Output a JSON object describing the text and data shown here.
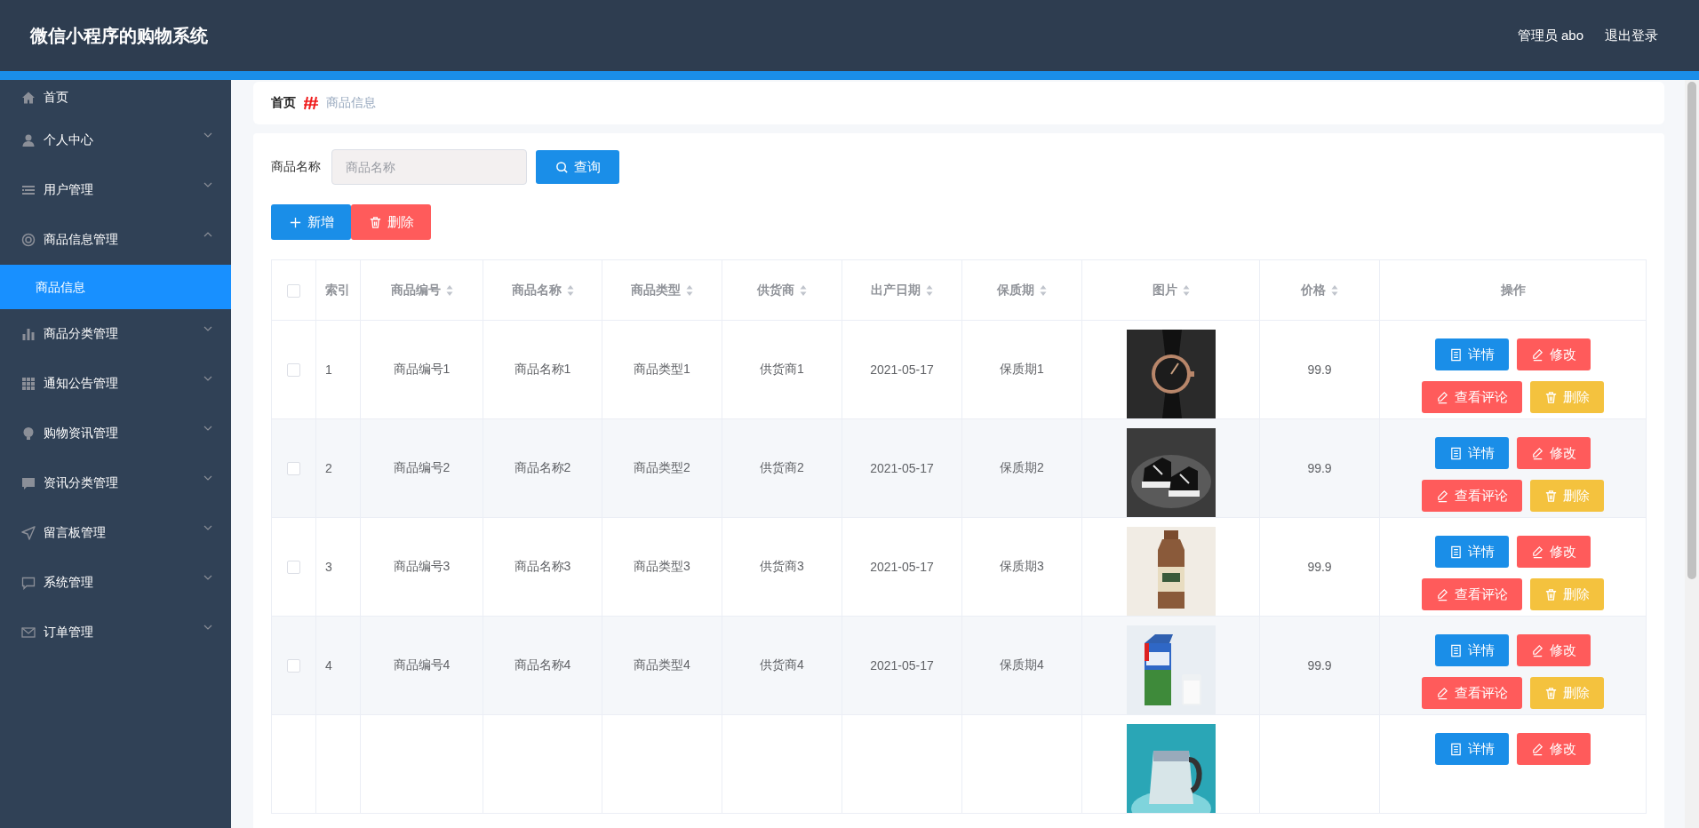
{
  "header": {
    "title": "微信小程序的购物系统",
    "user": "管理员 abo",
    "logout": "退出登录"
  },
  "sidebar": {
    "items": [
      {
        "label": "首页",
        "selected": false
      },
      {
        "label": "个人中心",
        "selected": false,
        "expanded": false
      },
      {
        "label": "用户管理",
        "selected": false,
        "expanded": false
      },
      {
        "label": "商品信息管理",
        "selected": false,
        "expanded": true,
        "children": [
          {
            "label": "商品信息",
            "selected": true
          }
        ]
      },
      {
        "label": "商品分类管理",
        "selected": false,
        "expanded": false
      },
      {
        "label": "通知公告管理",
        "selected": false,
        "expanded": false
      },
      {
        "label": "购物资讯管理",
        "selected": false,
        "expanded": false
      },
      {
        "label": "资讯分类管理",
        "selected": false,
        "expanded": false
      },
      {
        "label": "留言板管理",
        "selected": false,
        "expanded": false
      },
      {
        "label": "系统管理",
        "selected": false,
        "expanded": false
      },
      {
        "label": "订单管理",
        "selected": false,
        "expanded": false
      }
    ]
  },
  "breadcrumb": {
    "home": "首页",
    "current": "商品信息"
  },
  "search": {
    "label": "商品名称",
    "placeholder": "商品名称",
    "button": "查询"
  },
  "toolbar": [
    {
      "label": "新增",
      "kind": "add"
    },
    {
      "label": "删除",
      "kind": "delete"
    }
  ],
  "table": {
    "header_checked": false,
    "columns": [
      {
        "label": "索引",
        "sortable": false
      },
      {
        "label": "商品编号",
        "sortable": true
      },
      {
        "label": "商品名称",
        "sortable": true
      },
      {
        "label": "商品类型",
        "sortable": true
      },
      {
        "label": "供货商",
        "sortable": true
      },
      {
        "label": "出产日期",
        "sortable": true
      },
      {
        "label": "保质期",
        "sortable": true
      },
      {
        "label": "图片",
        "sortable": true
      },
      {
        "label": "价格",
        "sortable": true
      },
      {
        "label": "操作",
        "sortable": false
      }
    ],
    "rows": [
      {
        "checked": false,
        "cells": [
          "1",
          "商品编号1",
          "商品名称1",
          "商品类型1",
          "供货商1",
          "2021-05-17",
          "保质期1"
        ],
        "picture": {
          "kind": "picture"
        },
        "price": "99.9",
        "actions": [
          {
            "label": "详情",
            "kind": "detail"
          },
          {
            "label": "修改",
            "kind": "edit"
          },
          {
            "label": "查看评论",
            "kind": "comments"
          },
          {
            "label": "删除",
            "kind": "delete"
          }
        ]
      },
      {
        "checked": false,
        "cells": [
          "2",
          "商品编号2",
          "商品名称2",
          "商品类型2",
          "供货商2",
          "2021-05-17",
          "保质期2"
        ],
        "picture": {
          "kind": "picture"
        },
        "price": "99.9",
        "actions": [
          {
            "label": "详情",
            "kind": "detail"
          },
          {
            "label": "修改",
            "kind": "edit"
          },
          {
            "label": "查看评论",
            "kind": "comments"
          },
          {
            "label": "删除",
            "kind": "delete"
          }
        ]
      },
      {
        "checked": false,
        "cells": [
          "3",
          "商品编号3",
          "商品名称3",
          "商品类型3",
          "供货商3",
          "2021-05-17",
          "保质期3"
        ],
        "picture": {
          "kind": "picture"
        },
        "price": "99.9",
        "actions": [
          {
            "label": "详情",
            "kind": "detail"
          },
          {
            "label": "修改",
            "kind": "edit"
          },
          {
            "label": "查看评论",
            "kind": "comments"
          },
          {
            "label": "删除",
            "kind": "delete"
          }
        ]
      },
      {
        "checked": false,
        "cells": [
          "4",
          "商品编号4",
          "商品名称4",
          "商品类型4",
          "供货商4",
          "2021-05-17",
          "保质期4"
        ],
        "picture": {
          "kind": "picture"
        },
        "price": "99.9",
        "actions": [
          {
            "label": "详情",
            "kind": "detail"
          },
          {
            "label": "修改",
            "kind": "edit"
          },
          {
            "label": "查看评论",
            "kind": "comments"
          },
          {
            "label": "删除",
            "kind": "delete"
          }
        ]
      },
      {
        "picture": {
          "kind": "picture"
        },
        "actions": [
          {
            "label": "详情",
            "kind": "detail"
          },
          {
            "label": "修改",
            "kind": "edit"
          }
        ]
      }
    ]
  }
}
